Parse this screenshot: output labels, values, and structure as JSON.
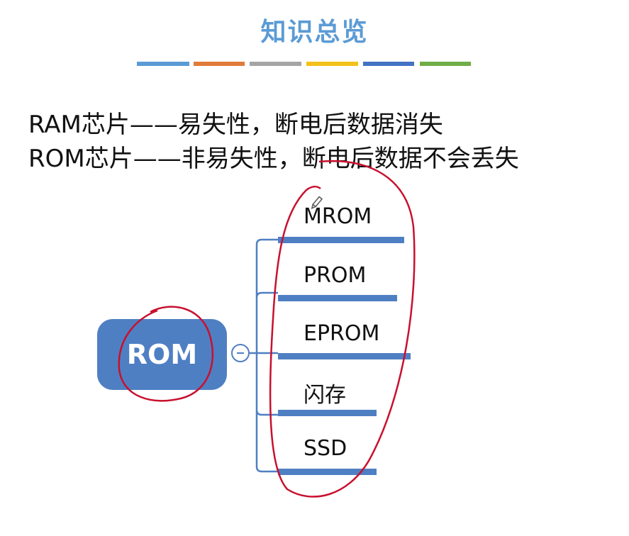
{
  "title": "知识总览",
  "colors": {
    "title": "#5b9bd5",
    "node": "#4f7fc3",
    "annotation": "#c8102e",
    "bars": [
      "#5b9bd5",
      "#e07b39",
      "#a5a5a5",
      "#f3c11b",
      "#4472c4",
      "#70ad47"
    ]
  },
  "lines": [
    "RAM芯片——易失性，断电后数据消失",
    "ROM芯片——非易失性，断电后数据不会丢失"
  ],
  "mindmap": {
    "root": "ROM",
    "collapse_icon": "minus-circle-icon",
    "branches": [
      "MROM",
      "PROM",
      "EPROM",
      "闪存",
      "SSD"
    ]
  },
  "annotation_icon": "pencil-icon"
}
